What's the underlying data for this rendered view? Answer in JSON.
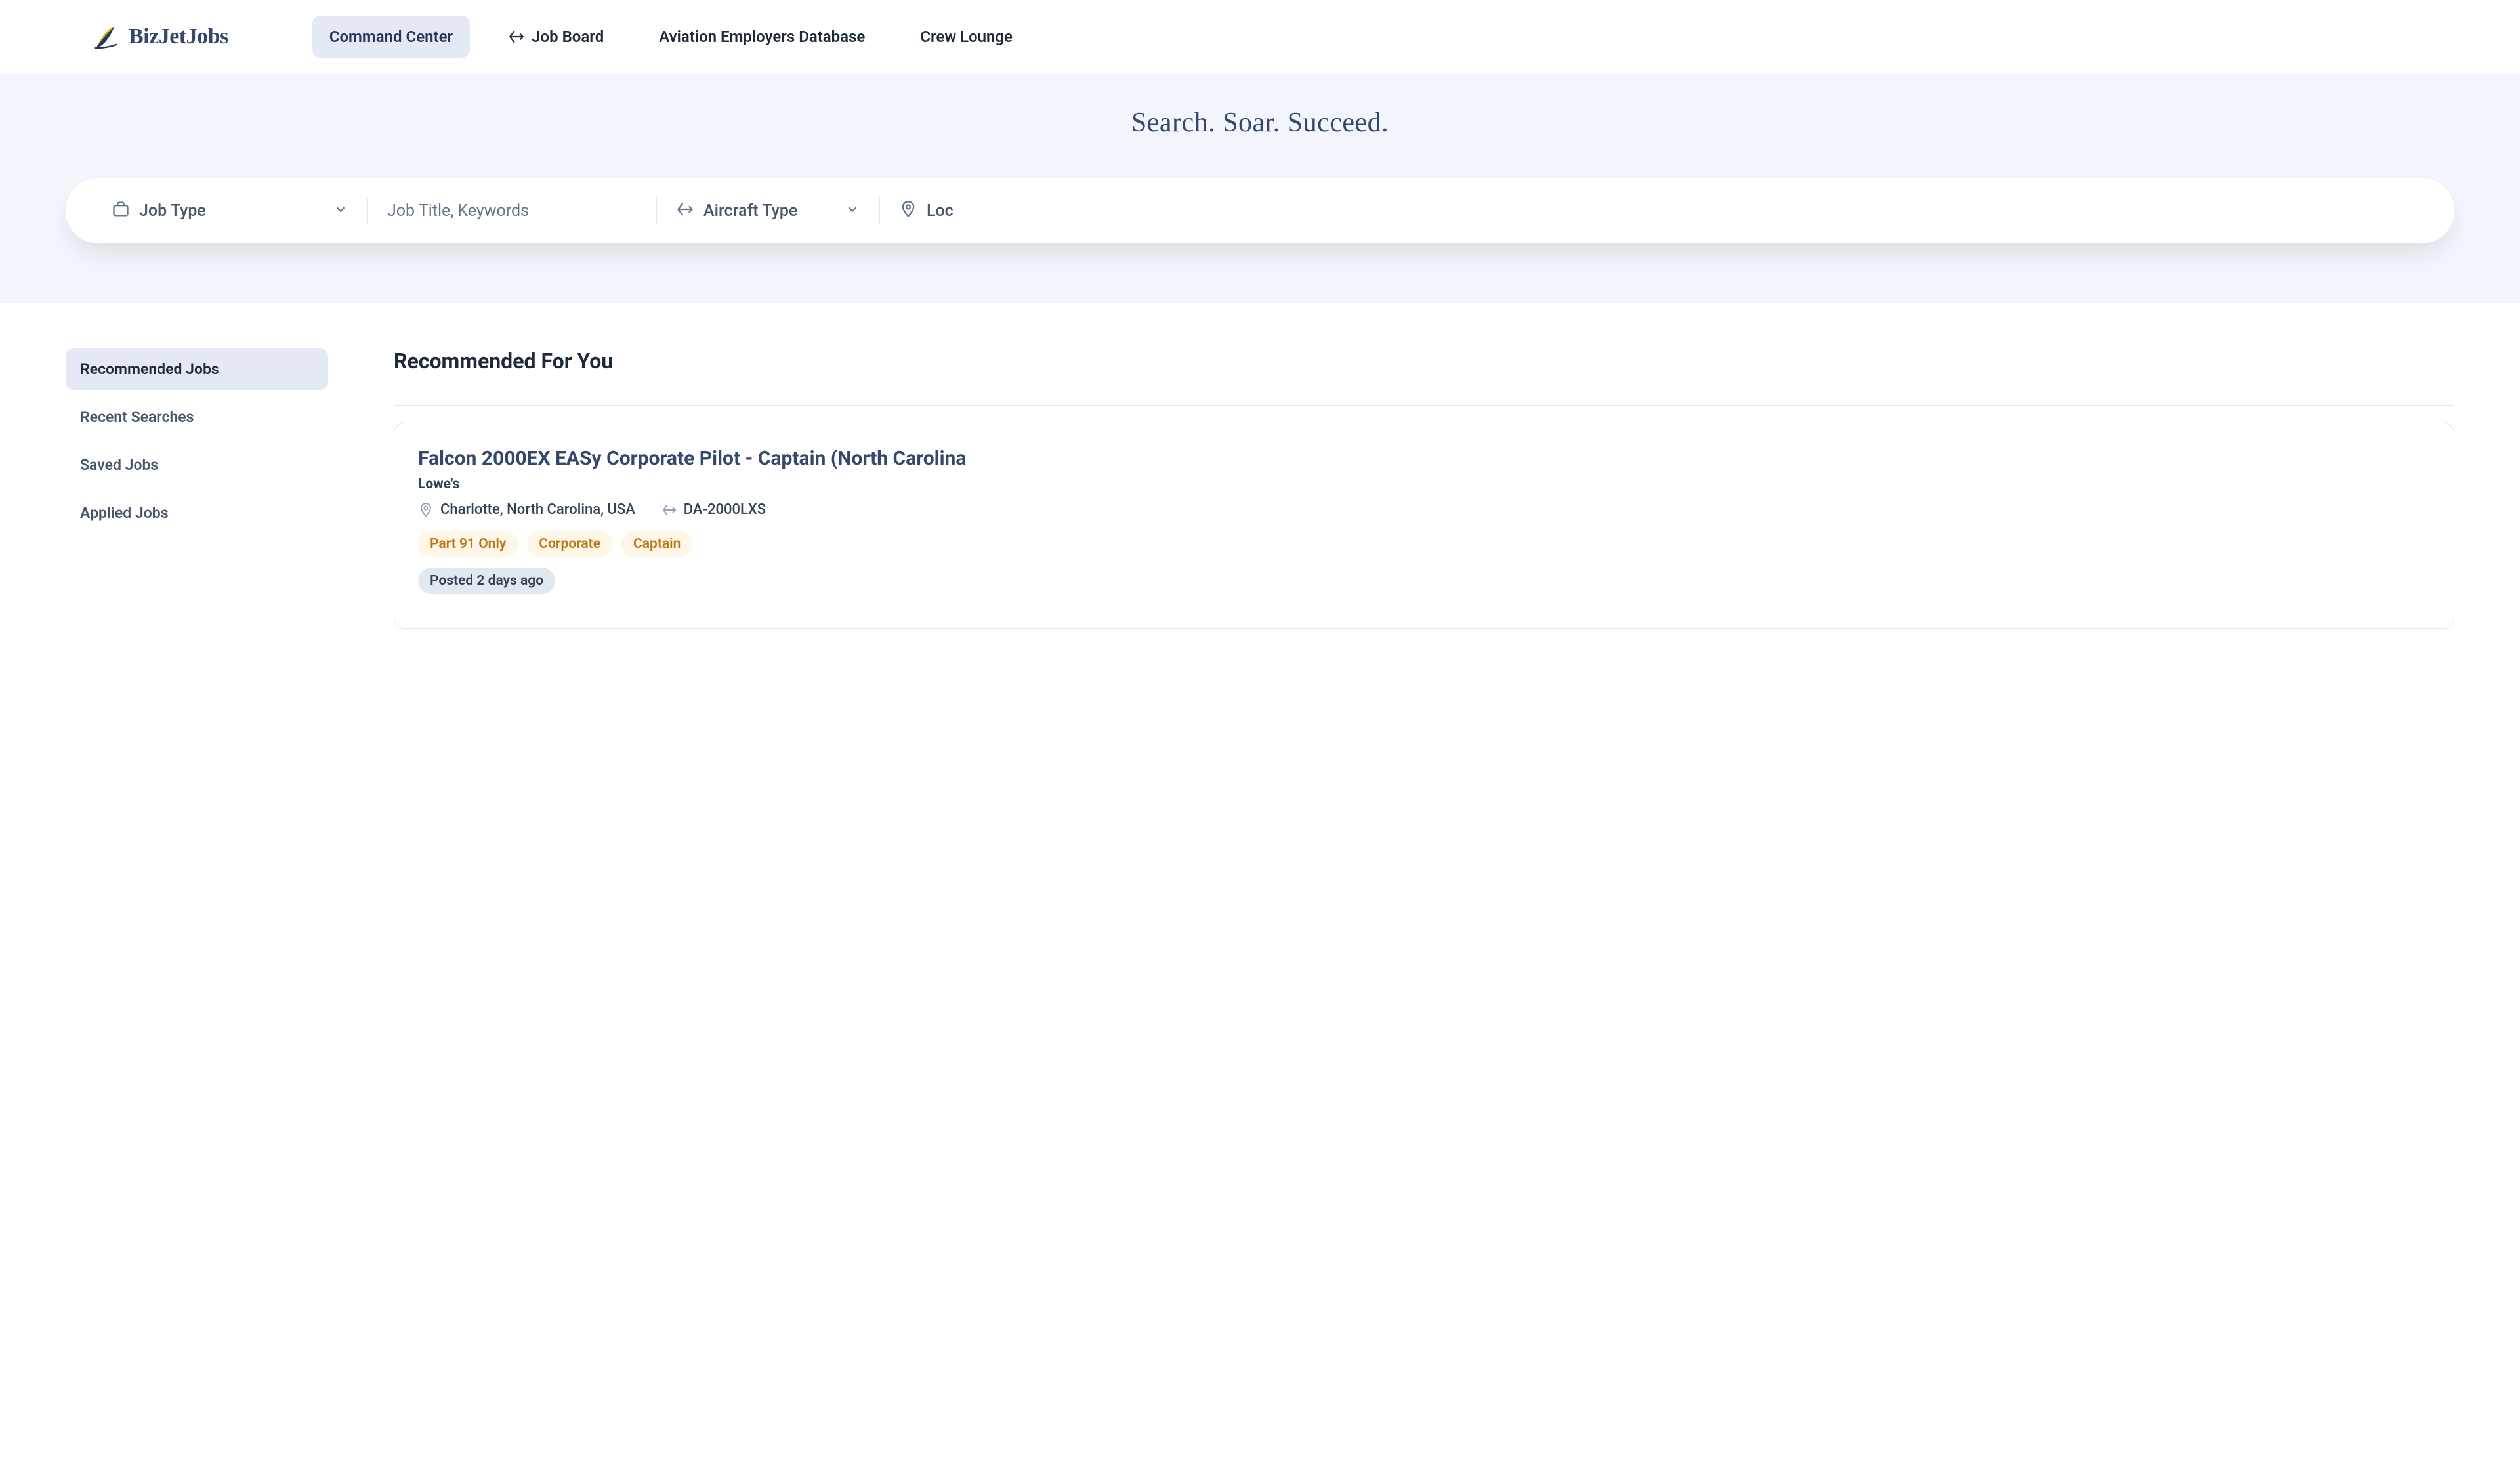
{
  "brand": {
    "name": "BizJetJobs"
  },
  "nav": {
    "items": [
      {
        "label": "Command Center",
        "active": true,
        "icon": null
      },
      {
        "label": "Job Board",
        "active": false,
        "icon": "plane"
      },
      {
        "label": "Aviation Employers Database",
        "active": false,
        "icon": null
      },
      {
        "label": "Crew Lounge",
        "active": false,
        "icon": null
      }
    ]
  },
  "hero": {
    "tagline": "Search. Soar. Succeed.",
    "search": {
      "jobtype_label": "Job Type",
      "keywords_placeholder": "Job Title, Keywords",
      "aircraft_label": "Aircraft Type",
      "location_label": "Loc"
    }
  },
  "sidebar": {
    "items": [
      {
        "label": "Recommended Jobs",
        "active": true
      },
      {
        "label": "Recent Searches",
        "active": false
      },
      {
        "label": "Saved Jobs",
        "active": false
      },
      {
        "label": "Applied Jobs",
        "active": false
      }
    ]
  },
  "content": {
    "section_title": "Recommended For You",
    "jobs": [
      {
        "title": "Falcon 2000EX EASy Corporate Pilot - Captain (North Carolina",
        "company": "Lowe's",
        "location": "Charlotte, North Carolina, USA",
        "aircraft": "DA-2000LXS",
        "tags": [
          "Part 91 Only",
          "Corporate",
          "Captain"
        ],
        "posted": "Posted 2 days ago"
      }
    ]
  }
}
